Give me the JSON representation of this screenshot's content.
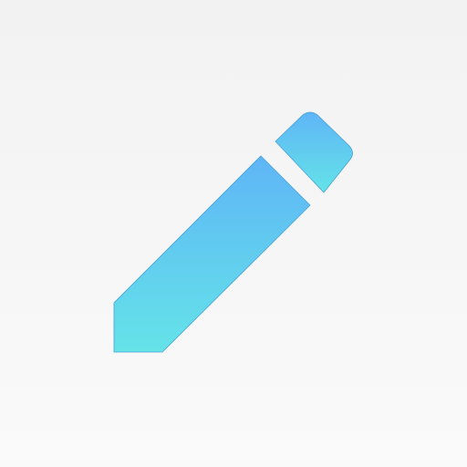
{
  "icon": {
    "name": "pencil-icon",
    "colors": {
      "background_top": "#f2f2f2",
      "background_bottom": "#fafafa",
      "pencil_top": "#5fb5f6",
      "pencil_bottom": "#64e3e8",
      "stroke": "#4aa2d6"
    }
  }
}
